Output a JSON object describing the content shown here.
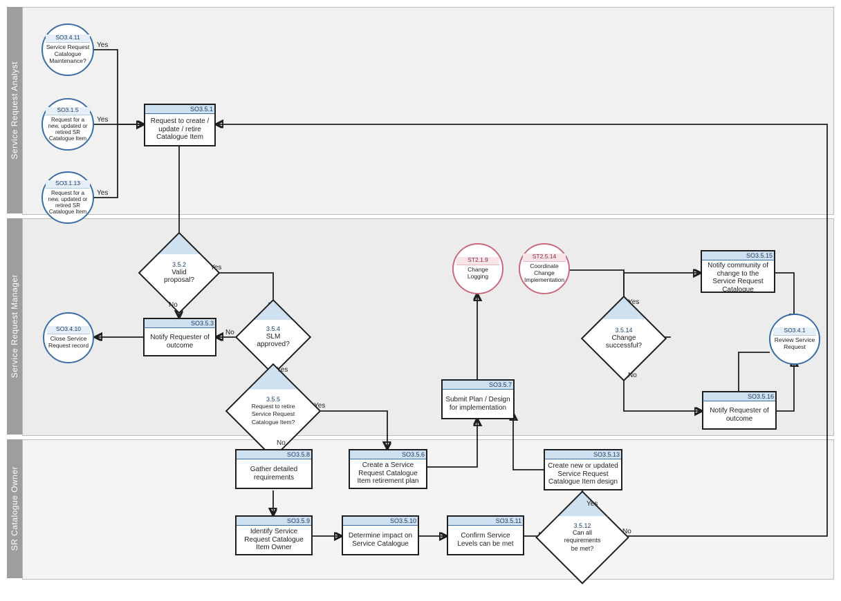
{
  "swimlanes": [
    {
      "id": "lane-analyst",
      "label": "Service Request Analyst"
    },
    {
      "id": "lane-manager",
      "label": "Service Request Manager"
    },
    {
      "id": "lane-owner",
      "label": "SR Catalogue Owner"
    }
  ],
  "nodes": {
    "c_so3411": {
      "kind": "circle",
      "code": "SO3.4.11",
      "text": "Service Request Catalogue Maintenance?"
    },
    "c_so315": {
      "kind": "circle",
      "code": "SO3.1.5",
      "text": "Request for a new, updated or retired SR Catalogue Item"
    },
    "c_so3113": {
      "kind": "circle",
      "code": "SO3.1.13",
      "text": "Request for a new, updated or retired SR Catalogue Item"
    },
    "p_so351": {
      "kind": "process",
      "code": "SO3.5.1",
      "text": "Request to create / update / retire Catalogue Item"
    },
    "d_352": {
      "kind": "decision",
      "code": "3.5.2",
      "text": "Valid proposal?"
    },
    "p_so353": {
      "kind": "process",
      "code": "SO3.5.3",
      "text": "Notify Requester of outcome"
    },
    "c_so3410": {
      "kind": "circle",
      "code": "SO3.4.10",
      "text": "Close Service Request record"
    },
    "d_354": {
      "kind": "decision",
      "code": "3.5.4",
      "text": "SLM approved?"
    },
    "d_355": {
      "kind": "decision",
      "code": "3.5.5",
      "text": "Request to retire Service Request Catalogue Item?"
    },
    "p_so356": {
      "kind": "process",
      "code": "SO3.5.6",
      "text": "Create a Service Request Catalogue Item retirement plan"
    },
    "p_so357": {
      "kind": "process",
      "code": "SO3.5.7",
      "text": "Submit Plan / Design for implementation"
    },
    "c_st219": {
      "kind": "circle-pink",
      "code": "ST2.1.9",
      "text": "Change Logging"
    },
    "c_st2514": {
      "kind": "circle-pink",
      "code": "ST2.5.14",
      "text": "Coordinate Change Implementation"
    },
    "d_3514": {
      "kind": "decision",
      "code": "3.5.14",
      "text": "Change successful?"
    },
    "p_so3515": {
      "kind": "process",
      "code": "SO3.5.15",
      "text": "Notify community of change to the Service Request Catalogue"
    },
    "p_so3516": {
      "kind": "process",
      "code": "SO3.5.16",
      "text": "Notify Requester of outcome"
    },
    "c_so341": {
      "kind": "circle",
      "code": "SO3.4.1",
      "text": "Review Service Request"
    },
    "p_so358": {
      "kind": "process",
      "code": "SO3.5.8",
      "text": "Gather detailed requirements"
    },
    "p_so359": {
      "kind": "process",
      "code": "SO3.5.9",
      "text": "Identify Service Request Catalogue Item Owner"
    },
    "p_so3510": {
      "kind": "process",
      "code": "SO3.5.10",
      "text": "Determine impact on Service Catalogue"
    },
    "p_so3511": {
      "kind": "process",
      "code": "SO3.5.11",
      "text": "Confirm Service Levels can be met"
    },
    "d_3512": {
      "kind": "decision",
      "code": "3.5.12",
      "text": "Can all requirements be met?"
    },
    "p_so3513": {
      "kind": "process",
      "code": "SO3.5.13",
      "text": "Create new or updated Service Request Catalogue Item design"
    }
  },
  "edge_labels": {
    "yes": "Yes",
    "no": "No"
  },
  "chart_data": {
    "type": "swimlane-flowchart",
    "lanes": [
      "Service Request Analyst",
      "Service Request Manager",
      "SR Catalogue Owner"
    ],
    "edges": [
      {
        "from": "c_so3411",
        "to": "p_so351",
        "label": "Yes"
      },
      {
        "from": "c_so315",
        "to": "p_so351",
        "label": "Yes"
      },
      {
        "from": "c_so3113",
        "to": "p_so351",
        "label": "Yes"
      },
      {
        "from": "p_so351",
        "to": "d_352"
      },
      {
        "from": "d_352",
        "to": "p_so353",
        "label": "No"
      },
      {
        "from": "d_352",
        "to": "d_354",
        "label": "Yes"
      },
      {
        "from": "p_so353",
        "to": "c_so3410"
      },
      {
        "from": "d_354",
        "to": "p_so353",
        "label": "No"
      },
      {
        "from": "d_354",
        "to": "d_355",
        "label": "Yes"
      },
      {
        "from": "d_355",
        "to": "p_so356",
        "label": "Yes"
      },
      {
        "from": "d_355",
        "to": "p_so358",
        "label": "No"
      },
      {
        "from": "p_so356",
        "to": "p_so357"
      },
      {
        "from": "p_so357",
        "to": "c_st219"
      },
      {
        "from": "c_st2514",
        "to": "d_3514"
      },
      {
        "from": "d_3514",
        "to": "p_so3515",
        "label": "Yes"
      },
      {
        "from": "d_3514",
        "to": "p_so3516",
        "label": "No"
      },
      {
        "from": "p_so3515",
        "to": "c_so341"
      },
      {
        "from": "p_so3516",
        "to": "c_so341"
      },
      {
        "from": "p_so358",
        "to": "p_so359"
      },
      {
        "from": "p_so359",
        "to": "p_so3510"
      },
      {
        "from": "p_so3510",
        "to": "p_so3511"
      },
      {
        "from": "p_so3511",
        "to": "d_3512"
      },
      {
        "from": "d_3512",
        "to": "p_so3513",
        "label": "Yes"
      },
      {
        "from": "d_3512",
        "to": "p_so351",
        "label": "No"
      },
      {
        "from": "p_so3513",
        "to": "p_so357"
      }
    ]
  }
}
